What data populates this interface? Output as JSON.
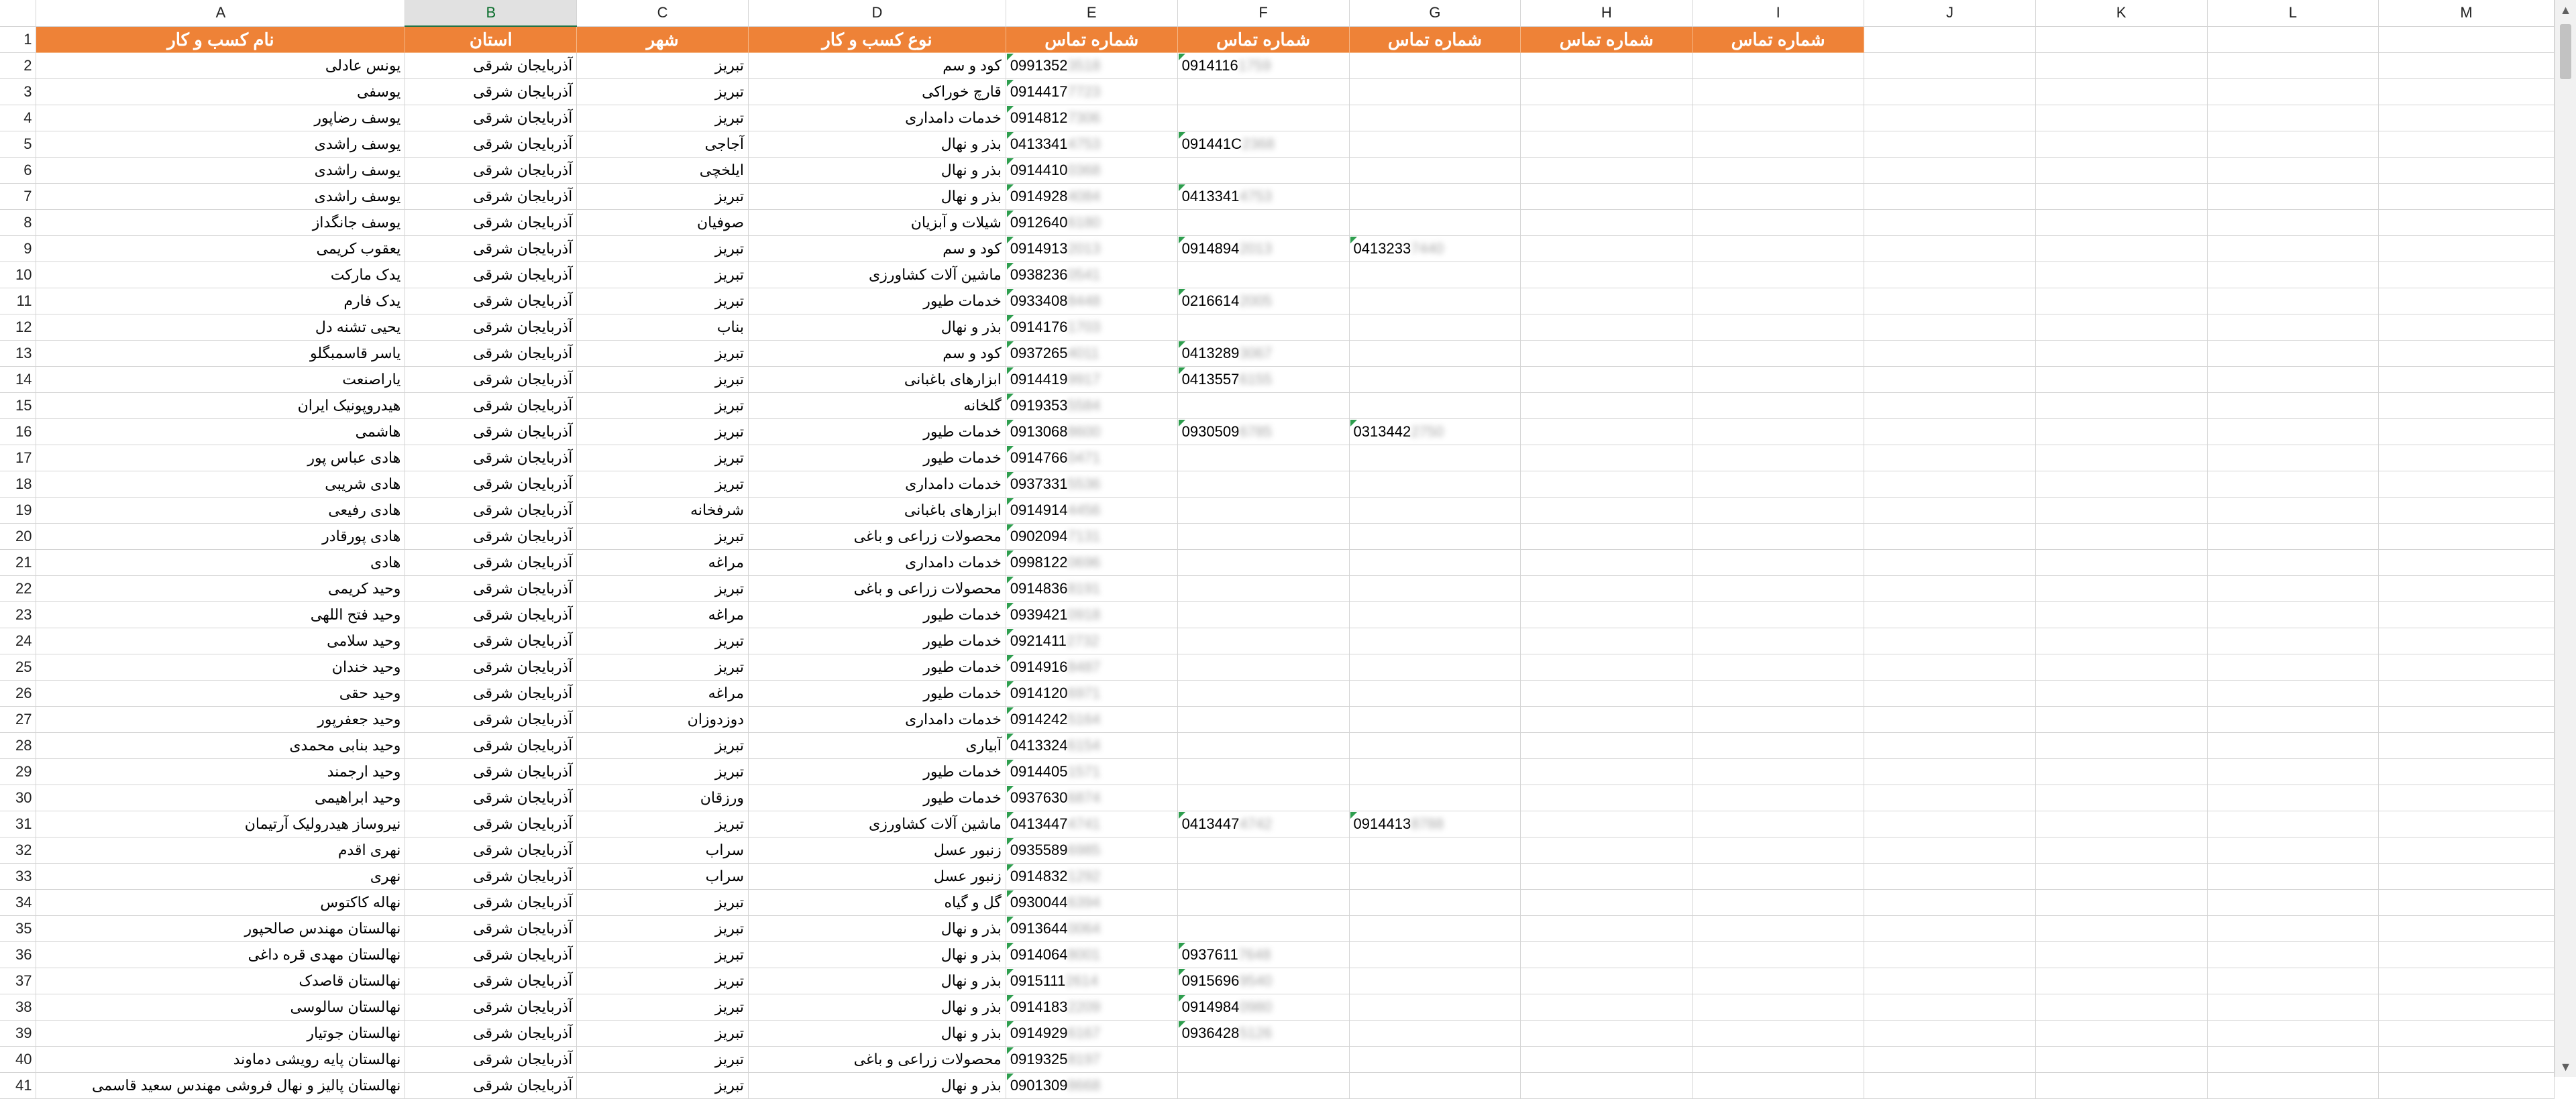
{
  "columns": [
    "",
    "A",
    "B",
    "C",
    "D",
    "E",
    "F",
    "G",
    "H",
    "I",
    "J",
    "K",
    "L",
    "M"
  ],
  "selected_column": "B",
  "accent_header_color": "#ee8237",
  "headers": [
    "نام کسب و کار",
    "استان",
    "شهر",
    "نوع کسب و کار",
    "شماره تماس",
    "شماره تماس",
    "شماره تماس",
    "شماره تماس",
    "شماره تماس"
  ],
  "rows": [
    {
      "n": "2",
      "a": "یونس عادلی",
      "b": "آذربایجان شرقی",
      "c": "تبریز",
      "d": "کود و سم",
      "e": "0991352",
      "e2": "3518",
      "f": "0914116",
      "f2": "1759",
      "g": "",
      "g2": ""
    },
    {
      "n": "3",
      "a": "یوسفی",
      "b": "آذربایجان شرقی",
      "c": "تبریز",
      "d": "قارچ خوراکی",
      "e": "0914417",
      "e2": "7723",
      "f": "",
      "f2": "",
      "g": "",
      "g2": ""
    },
    {
      "n": "4",
      "a": "یوسف رضاپور",
      "b": "آذربایجان شرقی",
      "c": "تبریز",
      "d": "خدمات دامداری",
      "e": "0914812",
      "e2": "7306",
      "f": "",
      "f2": "",
      "g": "",
      "g2": ""
    },
    {
      "n": "5",
      "a": "یوسف راشدی",
      "b": "آذربایجان شرقی",
      "c": "آجاجی",
      "d": "بذر و نهال",
      "e": "0413341",
      "e2": "4753",
      "f": "091441C",
      "f2": "2368",
      "g": "",
      "g2": ""
    },
    {
      "n": "6",
      "a": "یوسف راشدی",
      "b": "آذربایجان شرقی",
      "c": "ایلخچی",
      "d": "بذر و نهال",
      "e": "0914410",
      "e2": "0368",
      "f": "",
      "f2": "",
      "g": "",
      "g2": ""
    },
    {
      "n": "7",
      "a": "یوسف راشدی",
      "b": "آذربایجان شرقی",
      "c": "تبریز",
      "d": "بذر و نهال",
      "e": "0914928",
      "e2": "4084",
      "f": "0413341",
      "f2": "4753",
      "g": "",
      "g2": ""
    },
    {
      "n": "8",
      "a": "یوسف جانگداز",
      "b": "آذربایجان شرقی",
      "c": "صوفیان",
      "d": "شیلات و آبزیان",
      "e": "0912640",
      "e2": "6180",
      "f": "",
      "f2": "",
      "g": "",
      "g2": ""
    },
    {
      "n": "9",
      "a": "یعقوب کریمی",
      "b": "آذربایجان شرقی",
      "c": "تبریز",
      "d": "کود و سم",
      "e": "0914913",
      "e2": "2013",
      "f": "0914894",
      "f2": "2013",
      "g": "0413233",
      "g2": "7440"
    },
    {
      "n": "10",
      "a": "یدک مارکت",
      "b": "آذربایجان شرقی",
      "c": "تبریز",
      "d": "ماشین آلات کشاورزی",
      "e": "0938236",
      "e2": "0541",
      "f": "",
      "f2": "",
      "g": "",
      "g2": ""
    },
    {
      "n": "11",
      "a": "یدک فارم",
      "b": "آذربایجان شرقی",
      "c": "تبریز",
      "d": "خدمات طیور",
      "e": "0933408",
      "e2": "8448",
      "f": "0216614",
      "f2": "2005",
      "g": "",
      "g2": ""
    },
    {
      "n": "12",
      "a": "یحیی تشنه دل",
      "b": "آذربایجان شرقی",
      "c": "بناب",
      "d": "بذر و نهال",
      "e": "0914176",
      "e2": "1703",
      "f": "",
      "f2": "",
      "g": "",
      "g2": ""
    },
    {
      "n": "13",
      "a": "یاسر قاسمبگلو",
      "b": "آذربایجان شرقی",
      "c": "تبریز",
      "d": "کود و سم",
      "e": "0937265",
      "e2": "4011",
      "f": "0413289",
      "f2": "3067",
      "g": "",
      "g2": ""
    },
    {
      "n": "14",
      "a": "یاراصنعت",
      "b": "آذربایجان شرقی",
      "c": "تبریز",
      "d": "ابزارهای باغبانی",
      "e": "0914419",
      "e2": "9917",
      "f": "0413557",
      "f2": "6155",
      "g": "",
      "g2": ""
    },
    {
      "n": "15",
      "a": "هیدروپونیک ایران",
      "b": "آذربایجان شرقی",
      "c": "تبریز",
      "d": "گلخانه",
      "e": "0919353",
      "e2": "5584",
      "f": "",
      "f2": "",
      "g": "",
      "g2": ""
    },
    {
      "n": "16",
      "a": "هاشمی",
      "b": "آذربایجان شرقی",
      "c": "تبریز",
      "d": "خدمات طیور",
      "e": "0913068",
      "e2": "8600",
      "f": "0930509",
      "f2": "6785",
      "g": "0313442",
      "g2": "2750"
    },
    {
      "n": "17",
      "a": "هادی عباس پور",
      "b": "آذربایجان شرقی",
      "c": "تبریز",
      "d": "خدمات طیور",
      "e": "0914766",
      "e2": "0471",
      "f": "",
      "f2": "",
      "g": "",
      "g2": ""
    },
    {
      "n": "18",
      "a": "هادی شریبی",
      "b": "آذربایجان شرقی",
      "c": "تبریز",
      "d": "خدمات دامداری",
      "e": "0937331",
      "e2": "5536",
      "f": "",
      "f2": "",
      "g": "",
      "g2": ""
    },
    {
      "n": "19",
      "a": "هادی رفیعی",
      "b": "آذربایجان شرقی",
      "c": "شرفخانه",
      "d": "ابزارهای باغبانی",
      "e": "0914914",
      "e2": "4456",
      "f": "",
      "f2": "",
      "g": "",
      "g2": ""
    },
    {
      "n": "20",
      "a": "هادی پورقادر",
      "b": "آذربایجان شرقی",
      "c": "تبریز",
      "d": "محصولات زراعی و باغی",
      "e": "0902094",
      "e2": "7131",
      "f": "",
      "f2": "",
      "g": "",
      "g2": ""
    },
    {
      "n": "21",
      "a": "هادی",
      "b": "آذربایجان شرقی",
      "c": "مراغه",
      "d": "خدمات دامداری",
      "e": "0998122",
      "e2": "0696",
      "f": "",
      "f2": "",
      "g": "",
      "g2": ""
    },
    {
      "n": "22",
      "a": "وحید کریمی",
      "b": "آذربایجان شرقی",
      "c": "تبریز",
      "d": "محصولات زراعی و باغی",
      "e": "0914836",
      "e2": "8191",
      "f": "",
      "f2": "",
      "g": "",
      "g2": ""
    },
    {
      "n": "23",
      "a": "وحید فتح اللهی",
      "b": "آذربایجان شرقی",
      "c": "مراغه",
      "d": "خدمات طیور",
      "e": "0939421",
      "e2": "0918",
      "f": "",
      "f2": "",
      "g": "",
      "g2": ""
    },
    {
      "n": "24",
      "a": "وحید سلامی",
      "b": "آذربایجان شرقی",
      "c": "تبریز",
      "d": "خدمات طیور",
      "e": "0921411",
      "e2": "2732",
      "f": "",
      "f2": "",
      "g": "",
      "g2": ""
    },
    {
      "n": "25",
      "a": "وحید خندان",
      "b": "آذربایجان شرقی",
      "c": "تبریز",
      "d": "خدمات طیور",
      "e": "0914916",
      "e2": "8487",
      "f": "",
      "f2": "",
      "g": "",
      "g2": ""
    },
    {
      "n": "26",
      "a": "وحید حقی",
      "b": "آذربایجان شرقی",
      "c": "مراغه",
      "d": "خدمات طیور",
      "e": "0914120",
      "e2": "6971",
      "f": "",
      "f2": "",
      "g": "",
      "g2": ""
    },
    {
      "n": "27",
      "a": "وحید جعفرپور",
      "b": "آذربایجان شرقی",
      "c": "دوزدوزان",
      "d": "خدمات دامداری",
      "e": "0914242",
      "e2": "5164",
      "f": "",
      "f2": "",
      "g": "",
      "g2": ""
    },
    {
      "n": "28",
      "a": "وحید بنابی محمدی",
      "b": "آذربایجان شرقی",
      "c": "تبریز",
      "d": "آبیاری",
      "e": "0413324",
      "e2": "6154",
      "f": "",
      "f2": "",
      "g": "",
      "g2": ""
    },
    {
      "n": "29",
      "a": "وحید ارجمند",
      "b": "آذربایجان شرقی",
      "c": "تبریز",
      "d": "خدمات طیور",
      "e": "0914405",
      "e2": "1571",
      "f": "",
      "f2": "",
      "g": "",
      "g2": ""
    },
    {
      "n": "30",
      "a": "وحید ابراهیمی",
      "b": "آذربایجان شرقی",
      "c": "ورزقان",
      "d": "خدمات طیور",
      "e": "0937630",
      "e2": "6874",
      "f": "",
      "f2": "",
      "g": "",
      "g2": ""
    },
    {
      "n": "31",
      "a": "نیروساز هیدرولیک آرتیمان",
      "b": "آذربایجان شرقی",
      "c": "تبریز",
      "d": "ماشین آلات کشاورزی",
      "e": "0413447",
      "e2": "4741",
      "f": "0413447",
      "f2": "4742",
      "g": "0914413",
      "g2": "8788"
    },
    {
      "n": "32",
      "a": "نهری اقدم",
      "b": "آذربایجان شرقی",
      "c": "سراب",
      "d": "زنبور عسل",
      "e": "0935589",
      "e2": "6985",
      "f": "",
      "f2": "",
      "g": "",
      "g2": ""
    },
    {
      "n": "33",
      "a": "نهری",
      "b": "آذربایجان شرقی",
      "c": "سراب",
      "d": "زنبور عسل",
      "e": "0914832",
      "e2": "1292",
      "f": "",
      "f2": "",
      "g": "",
      "g2": ""
    },
    {
      "n": "34",
      "a": "نهاله کاکتوس",
      "b": "آذربایجان شرقی",
      "c": "تبریز",
      "d": "گل و گیاه",
      "e": "0930044",
      "e2": "6394",
      "f": "",
      "f2": "",
      "g": "",
      "g2": ""
    },
    {
      "n": "35",
      "a": "نهالستان مهندس صالحپور",
      "b": "آذربایجان شرقی",
      "c": "تبریز",
      "d": "بذر و نهال",
      "e": "0913644",
      "e2": "0064",
      "f": "",
      "f2": "",
      "g": "",
      "g2": ""
    },
    {
      "n": "36",
      "a": "نهالستان مهدی قره داغی",
      "b": "آذربایجان شرقی",
      "c": "تبریز",
      "d": "بذر و نهال",
      "e": "0914064",
      "e2": "8001",
      "f": "0937611",
      "f2": "7648",
      "g": "",
      "g2": ""
    },
    {
      "n": "37",
      "a": "نهالستان قاصدک",
      "b": "آذربایجان شرقی",
      "c": "تبریز",
      "d": "بذر و نهال",
      "e": "0915111",
      "e2": "2614",
      "f": "0915696",
      "f2": "9540",
      "g": "",
      "g2": ""
    },
    {
      "n": "38",
      "a": "نهالستان سالوسی",
      "b": "آذربایجان شرقی",
      "c": "تبریز",
      "d": "بذر و نهال",
      "e": "0914183",
      "e2": "2209",
      "f": "0914984",
      "f2": "0980",
      "g": "",
      "g2": ""
    },
    {
      "n": "39",
      "a": "نهالستان جوتیار",
      "b": "آذربایجان شرقی",
      "c": "تبریز",
      "d": "بذر و نهال",
      "e": "0914929",
      "e2": "6167",
      "f": "0936428",
      "f2": "5126",
      "g": "",
      "g2": ""
    },
    {
      "n": "40",
      "a": "نهالستان پایه رویشی دماوند",
      "b": "آذربایجان شرقی",
      "c": "تبریز",
      "d": "محصولات زراعی و باغی",
      "e": "0919325",
      "e2": "8197",
      "f": "",
      "f2": "",
      "g": "",
      "g2": ""
    },
    {
      "n": "41",
      "a": "نهالستان پالیز و نهال فروشی مهندس سعید قاسمی",
      "b": "آذربایجان شرقی",
      "c": "تبریز",
      "d": "بذر و نهال",
      "e": "0901309",
      "e2": "8668",
      "f": "",
      "f2": "",
      "g": "",
      "g2": ""
    }
  ],
  "scrollbar": {
    "up_arrow": "▲",
    "down_arrow": "▼"
  }
}
